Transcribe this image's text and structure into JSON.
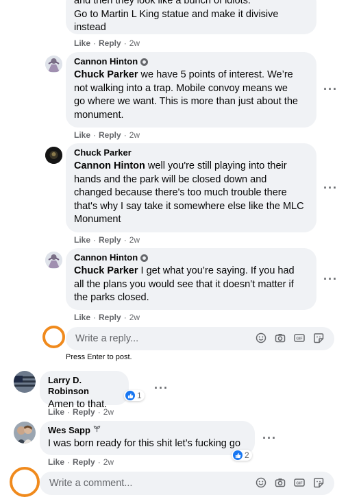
{
  "top_comment": {
    "partial_line": "and then they look like a bunch of idiots.",
    "line2": "Go to Martin L King statue and make it divisive",
    "line3": "instead",
    "like": "Like",
    "reply": "Reply",
    "time": "2w"
  },
  "reply1": {
    "author": "Cannon Hinton",
    "mention": "Chuck Parker",
    "line1": " we have 5 points of interest. We’re",
    "line2": "not walking into a trap. Mobile convoy means we",
    "line3": "go where we want. This is more than just about the",
    "line4": "monument.",
    "like": "Like",
    "reply": "Reply",
    "time": "2w"
  },
  "reply2": {
    "author": "Chuck Parker",
    "mention": "Cannon Hinton",
    "line1": " well you're still playing into their",
    "line2": "hands and the park will be closed down and",
    "line3": "changed because there's too much trouble there",
    "line4": "that's why I say take it somewhere else like the MLC",
    "line5": "Monument",
    "like": "Like",
    "reply": "Reply",
    "time": "2w"
  },
  "reply3": {
    "author": "Cannon Hinton",
    "mention": "Chuck Parker",
    "line1": " I get what you’re saying. If you had",
    "line2": "all the plans you would see that it doesn’t matter if",
    "line3": "the parks closed.",
    "like": "Like",
    "reply": "Reply",
    "time": "2w"
  },
  "reply_input": {
    "placeholder": "Write a reply...",
    "hint": "Press Enter to post."
  },
  "comment_larry": {
    "author": "Larry D. Robinson",
    "text": "Amen to that.",
    "reaction_count": "1",
    "like": "Like",
    "reply": "Reply",
    "time": "2w"
  },
  "comment_wes": {
    "author": "Wes Sapp",
    "text": "I was born ready for this shit let’s fucking go",
    "reaction_count": "2",
    "like": "Like",
    "reply": "Reply",
    "time": "2w"
  },
  "comment_input": {
    "placeholder": "Write a comment..."
  },
  "icons": {
    "composer": [
      "emoji-icon",
      "camera-icon",
      "gif-icon",
      "sticker-icon"
    ],
    "more": "more-options-icon",
    "reaction": "like-reaction-icon"
  },
  "colors": {
    "bubble": "#f0f2f5",
    "meta": "#65676b",
    "accent": "#1877f2",
    "annotation": "#f08a1d"
  }
}
